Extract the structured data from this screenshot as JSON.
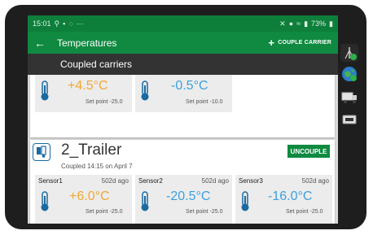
{
  "status": {
    "time": "15:01",
    "battery": "73%"
  },
  "appbar": {
    "title": "Temperatures",
    "couple_label": "COUPLE CARRIER",
    "back_glyph": "←",
    "plus_glyph": "+"
  },
  "subbar": {
    "title": "Coupled carriers"
  },
  "top_card": {
    "sensors": [
      {
        "temp": "+4.5°C",
        "set_point": "Set point -25.0",
        "color": "#f0a830"
      },
      {
        "temp": "-0.5°C",
        "set_point": "Set point -10.0",
        "color": "#3aa0e0"
      }
    ]
  },
  "trailer": {
    "name": "2_Trailer",
    "coupled": "Coupled 14:15 on April 7",
    "uncouple_label": "UNCOUPLE",
    "sensors": [
      {
        "name": "Sensor1",
        "ago": "502d ago",
        "temp": "+6.0°C",
        "set_point": "Set point -25.0",
        "color": "#f0a830"
      },
      {
        "name": "Sensor2",
        "ago": "502d ago",
        "temp": "-20.5°C",
        "set_point": "Set point -25.0",
        "color": "#3aa0e0"
      },
      {
        "name": "Sensor3",
        "ago": "502d ago",
        "temp": "-16.0°C",
        "set_point": "Set point -25.0",
        "color": "#3aa0e0"
      }
    ]
  },
  "colors": {
    "primary": "#0f8a40",
    "dark_bar": "#333333",
    "warm": "#f0a830",
    "cold": "#3aa0e0"
  },
  "side_icons": [
    "antenna-icon",
    "globe-icon",
    "truck-icon",
    "trailer-icon"
  ]
}
